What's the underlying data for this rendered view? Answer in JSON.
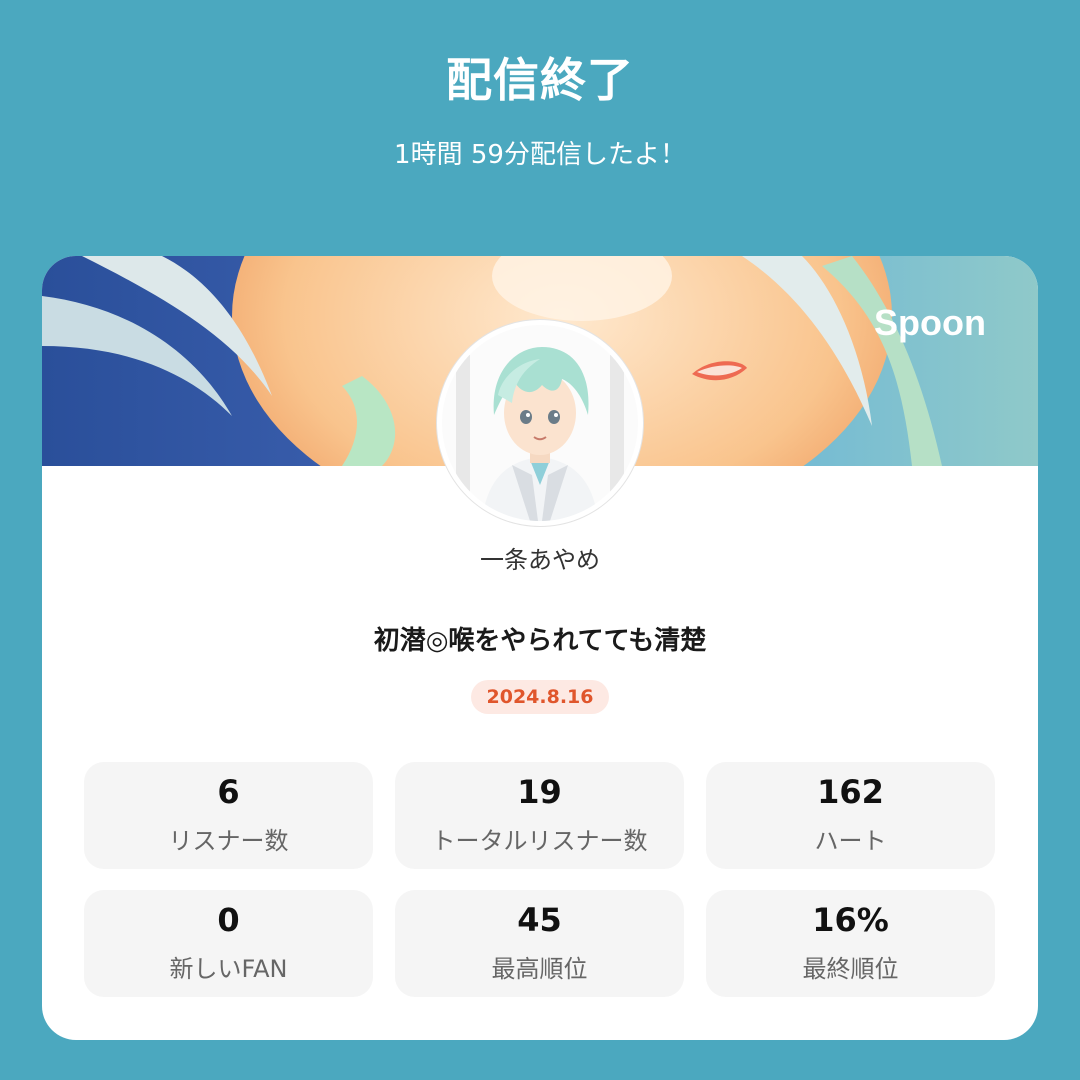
{
  "header": {
    "title": "配信終了",
    "subtitle": "1時間 59分配信したよ！"
  },
  "card": {
    "brand": "Spoon",
    "username": "一条あやめ",
    "stream_title": "初潜◎喉をやられてても清楚",
    "date": "2024.8.16"
  },
  "stats": [
    {
      "value": "6",
      "label": "リスナー数"
    },
    {
      "value": "19",
      "label": "トータルリスナー数"
    },
    {
      "value": "162",
      "label": "ハート"
    },
    {
      "value": "0",
      "label": "新しいFAN"
    },
    {
      "value": "45",
      "label": "最高順位"
    },
    {
      "value": "16%",
      "label": "最終順位"
    }
  ],
  "colors": {
    "background": "#4ba8bf",
    "card": "#ffffff",
    "date_text": "#e0562c",
    "date_bg": "#fde9e3",
    "stat_bg": "#f5f5f5"
  }
}
